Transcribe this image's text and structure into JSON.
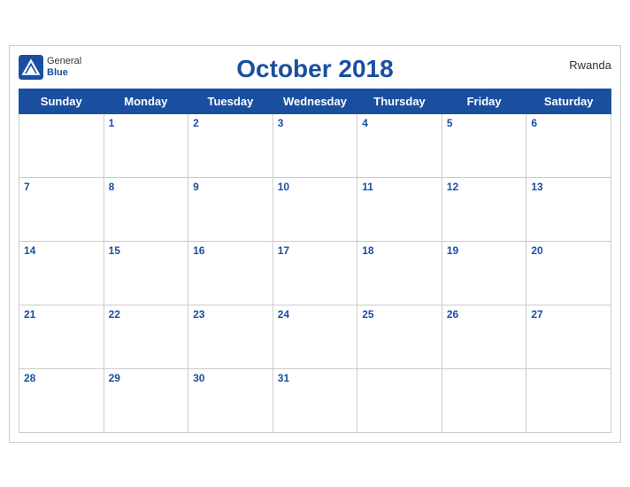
{
  "header": {
    "logo_general": "General",
    "logo_blue": "Blue",
    "title": "October 2018",
    "country": "Rwanda"
  },
  "weekdays": [
    "Sunday",
    "Monday",
    "Tuesday",
    "Wednesday",
    "Thursday",
    "Friday",
    "Saturday"
  ],
  "weeks": [
    [
      null,
      1,
      2,
      3,
      4,
      5,
      6
    ],
    [
      7,
      8,
      9,
      10,
      11,
      12,
      13
    ],
    [
      14,
      15,
      16,
      17,
      18,
      19,
      20
    ],
    [
      21,
      22,
      23,
      24,
      25,
      26,
      27
    ],
    [
      28,
      29,
      30,
      31,
      null,
      null,
      null
    ]
  ]
}
